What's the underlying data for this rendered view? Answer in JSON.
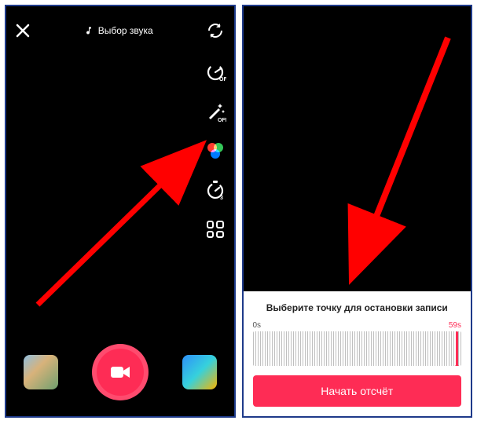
{
  "left": {
    "sound_label": "Выбор звука",
    "tools": {
      "speed_badge": "OFF",
      "beauty_badge": "OFF",
      "timer_badge": "3"
    }
  },
  "right": {
    "sheet_title": "Выберите точку для остановки записи",
    "wave_start": "0s",
    "wave_end": "59s",
    "start_button": "Начать отсчёт"
  }
}
